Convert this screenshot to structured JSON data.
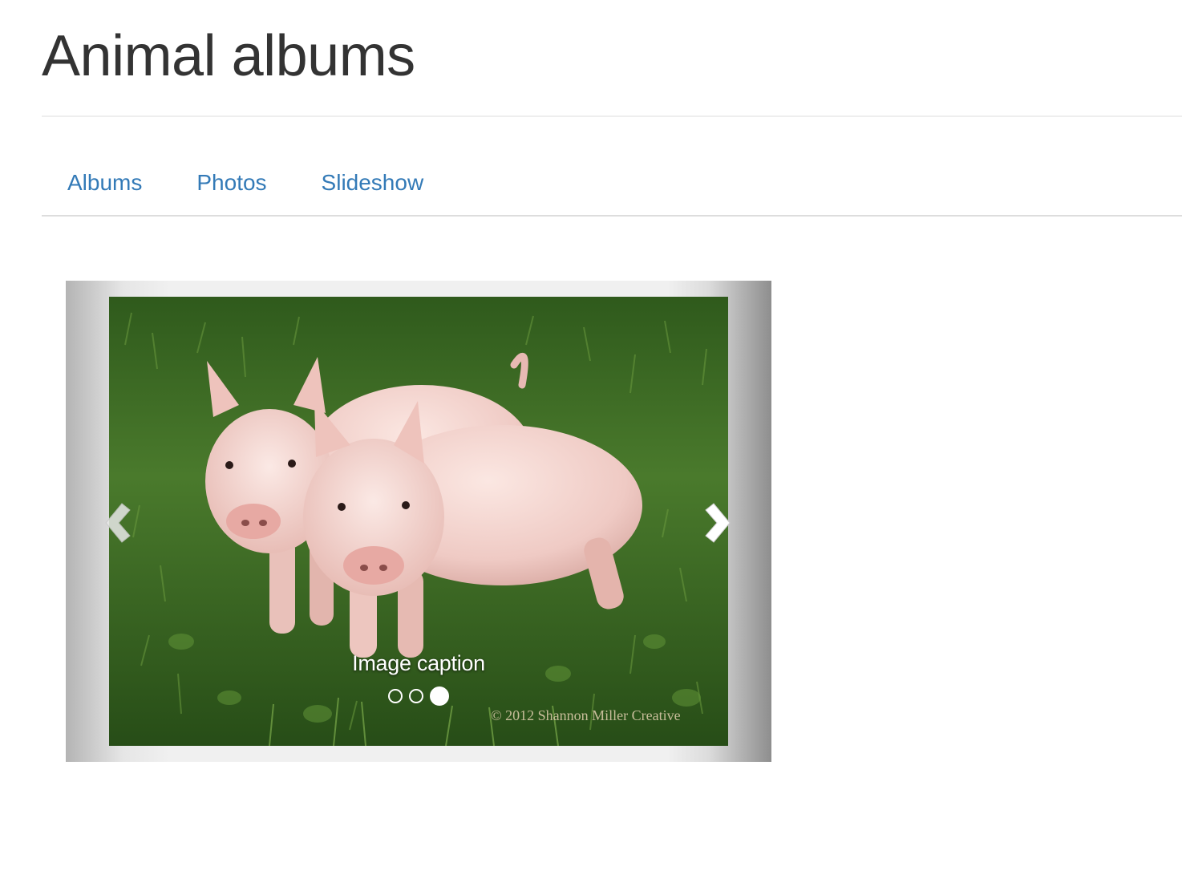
{
  "header": {
    "title": "Animal albums"
  },
  "nav": {
    "tabs": [
      {
        "label": "Albums"
      },
      {
        "label": "Photos"
      },
      {
        "label": "Slideshow"
      }
    ]
  },
  "carousel": {
    "caption": "Image caption",
    "watermark": "© 2012 Shannon Miller Creative",
    "slide_count": 3,
    "active_index": 2,
    "prev_icon": "chevron-left-icon",
    "next_icon": "chevron-right-icon"
  },
  "colors": {
    "link": "#337ab7",
    "title": "#333333",
    "grass": "#3f6b26",
    "pig": "#f2d3d0"
  }
}
